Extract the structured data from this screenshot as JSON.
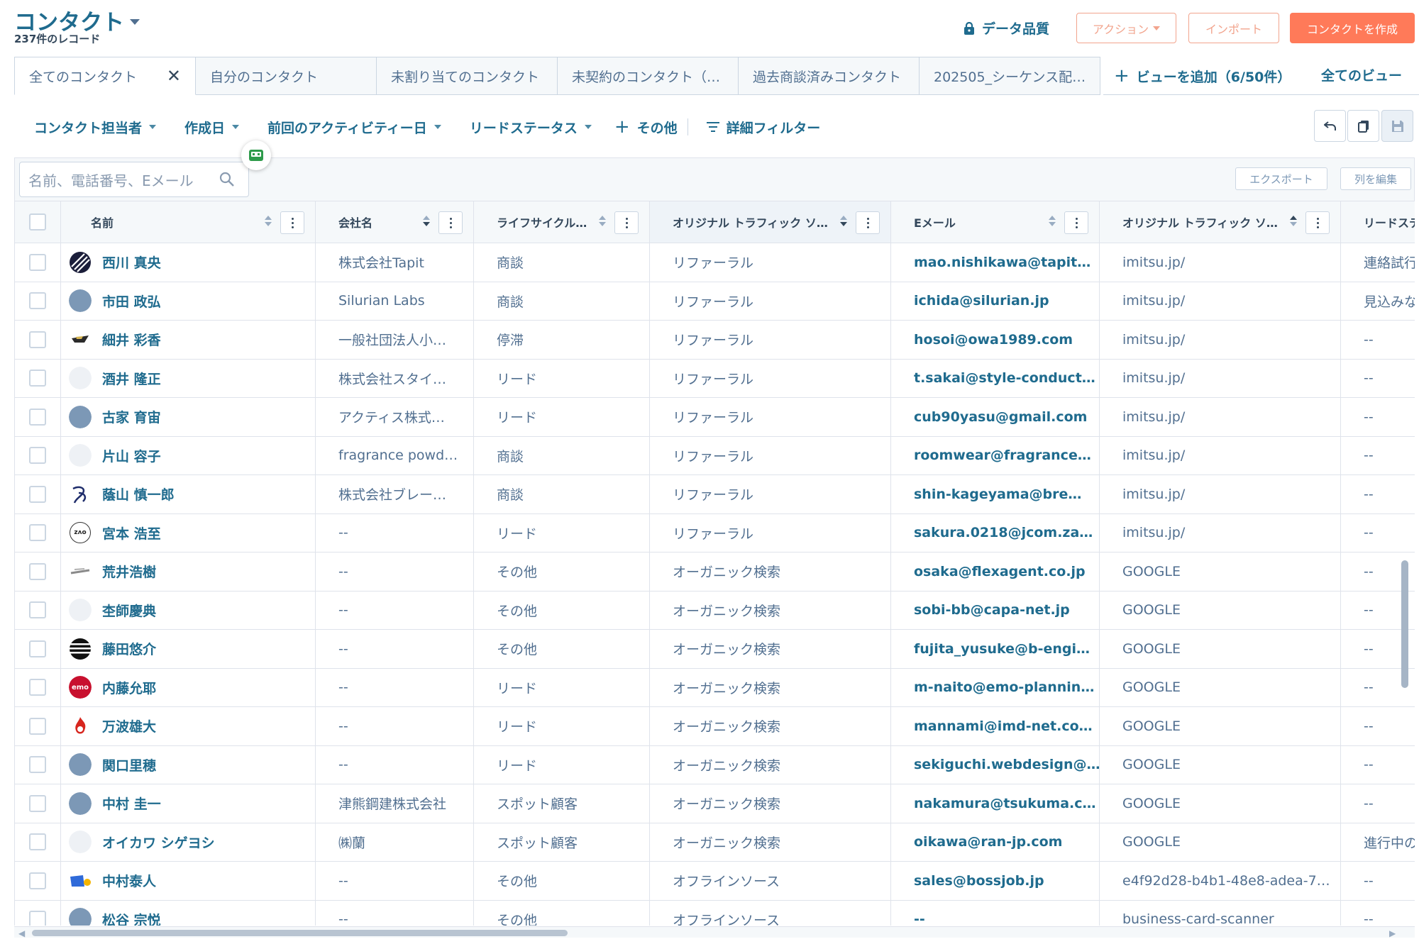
{
  "header": {
    "title": "コンタクト",
    "record_count": "237件のレコード",
    "data_quality": "データ品質",
    "actions_label": "アクション",
    "import_label": "インポート",
    "create_label": "コンタクトを作成"
  },
  "tabs": [
    {
      "label": "全てのコンタクト"
    },
    {
      "label": "自分のコンタクト"
    },
    {
      "label": "未割り当てのコンタクト"
    },
    {
      "label": "未契約のコンタクト（…"
    },
    {
      "label": "過去商談済みコンタクト"
    },
    {
      "label": "202505_シーケンス配…"
    }
  ],
  "add_view": "ビューを追加（6/50件）",
  "all_views": "全てのビュー",
  "filters": {
    "owner": "コンタクト担当者",
    "created": "作成日",
    "last_activity": "前回のアクティビティー日",
    "lead_status": "リードステータス",
    "more": "その他",
    "advanced": "詳細フィルター"
  },
  "table_toolbar": {
    "search_placeholder": "名前、電話番号、Eメール",
    "export": "エクスポート",
    "edit_columns": "列を編集"
  },
  "columns": [
    "名前",
    "会社名",
    "ライフサイクル…",
    "オリジナル トラフィック ソ…",
    "Eメール",
    "オリジナル トラフィック ソ…",
    "リードステ"
  ],
  "rows": [
    {
      "name": "西川 真央",
      "company": "株式会社Tapit",
      "lifecycle": "商談",
      "source": "リファーラル",
      "email": "mao.nishikawa@tapit…",
      "source2": "imitsu.jp/",
      "lead": "連絡試行"
    },
    {
      "name": "市田 政弘",
      "company": "Silurian Labs",
      "lifecycle": "商談",
      "source": "リファーラル",
      "email": "ichida@silurian.jp",
      "source2": "imitsu.jp/",
      "lead": "見込みな"
    },
    {
      "name": "細井 彩香",
      "company": "一般社団法人小…",
      "lifecycle": "停滞",
      "source": "リファーラル",
      "email": "hosoi@owa1989.com",
      "source2": "imitsu.jp/",
      "lead": "--"
    },
    {
      "name": "酒井 隆正",
      "company": "株式会社スタイ…",
      "lifecycle": "リード",
      "source": "リファーラル",
      "email": "t.sakai@style-conduct…",
      "source2": "imitsu.jp/",
      "lead": "--"
    },
    {
      "name": "古家 育宙",
      "company": "アクティス株式…",
      "lifecycle": "リード",
      "source": "リファーラル",
      "email": "cub90yasu@gmail.com",
      "source2": "imitsu.jp/",
      "lead": "--"
    },
    {
      "name": "片山 容子",
      "company": "fragrance powd…",
      "lifecycle": "商談",
      "source": "リファーラル",
      "email": "roomwear@fragrance…",
      "source2": "imitsu.jp/",
      "lead": "--"
    },
    {
      "name": "蔭山 慎一郎",
      "company": "株式会社ブレー…",
      "lifecycle": "商談",
      "source": "リファーラル",
      "email": "shin-kageyama@bre…",
      "source2": "imitsu.jp/",
      "lead": "--"
    },
    {
      "name": "宮本 浩至",
      "company": "--",
      "lifecycle": "リード",
      "source": "リファーラル",
      "email": "sakura.0218@jcom.za…",
      "source2": "imitsu.jp/",
      "lead": "--"
    },
    {
      "name": "荒井浩樹",
      "company": "--",
      "lifecycle": "その他",
      "source": "オーガニック検索",
      "email": "osaka@flexagent.co.jp",
      "source2": "GOOGLE",
      "lead": "--"
    },
    {
      "name": "杢師慶典",
      "company": "--",
      "lifecycle": "その他",
      "source": "オーガニック検索",
      "email": "sobi-bb@capa-net.jp",
      "source2": "GOOGLE",
      "lead": "--"
    },
    {
      "name": "藤田悠介",
      "company": "--",
      "lifecycle": "その他",
      "source": "オーガニック検索",
      "email": "fujita_yusuke@b-engi…",
      "source2": "GOOGLE",
      "lead": "--"
    },
    {
      "name": "内藤允耶",
      "company": "--",
      "lifecycle": "リード",
      "source": "オーガニック検索",
      "email": "m-naito@emo-plannin…",
      "source2": "GOOGLE",
      "lead": "--"
    },
    {
      "name": "万波雄大",
      "company": "--",
      "lifecycle": "リード",
      "source": "オーガニック検索",
      "email": "mannami@imd-net.co…",
      "source2": "GOOGLE",
      "lead": "--"
    },
    {
      "name": "関口里穂",
      "company": "--",
      "lifecycle": "リード",
      "source": "オーガニック検索",
      "email": "sekiguchi.webdesign@…",
      "source2": "GOOGLE",
      "lead": "--"
    },
    {
      "name": "中村 圭一",
      "company": "津熊鋼建株式会社",
      "lifecycle": "スポット顧客",
      "source": "オーガニック検索",
      "email": "nakamura@tsukuma.c…",
      "source2": "GOOGLE",
      "lead": "--"
    },
    {
      "name": "オイカワ シゲヨシ",
      "company": "㈱蘭",
      "lifecycle": "スポット顧客",
      "source": "オーガニック検索",
      "email": "oikawa@ran-jp.com",
      "source2": "GOOGLE",
      "lead": "進行中の"
    },
    {
      "name": "中村泰人",
      "company": "--",
      "lifecycle": "その他",
      "source": "オフラインソース",
      "email": "sales@bossjob.jp",
      "source2": "e4f92d28-b4b1-48e8-adea-7…",
      "lead": "--"
    },
    {
      "name": "松谷 宗悦",
      "company": "--",
      "lifecycle": "その他",
      "source": "オフラインソース",
      "email": "--",
      "source2": "business-card-scanner",
      "lead": "--"
    }
  ],
  "avatar_text": {
    "emo": "emo",
    "zao": "zʌo"
  }
}
